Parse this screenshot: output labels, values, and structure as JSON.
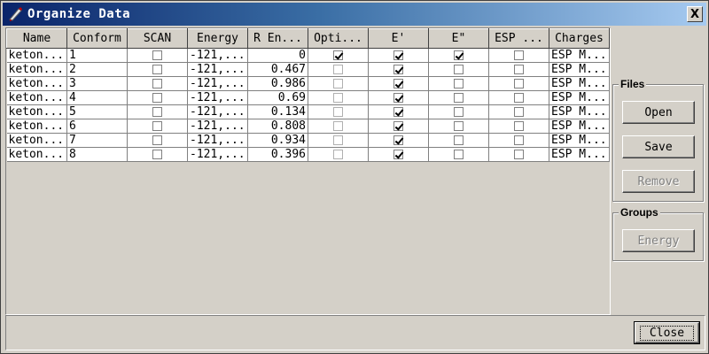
{
  "window": {
    "title": "Organize Data",
    "close_glyph": "X",
    "icon": "pen-icon"
  },
  "table": {
    "columns": [
      "Name",
      "Conform",
      "SCAN",
      "Energy",
      "R En...",
      "Opti...",
      "E'",
      "E\"",
      "ESP ...",
      "Charges"
    ],
    "rows": [
      {
        "name": "keton...",
        "conform": "1",
        "scan": false,
        "energy": "-121,...",
        "r_energy": "0",
        "opti": true,
        "e1": true,
        "e2": true,
        "esp": false,
        "charges": "ESP M..."
      },
      {
        "name": "keton...",
        "conform": "2",
        "scan": false,
        "energy": "-121,...",
        "r_energy": "0.467",
        "opti": false,
        "e1": true,
        "e2": false,
        "esp": false,
        "charges": "ESP M..."
      },
      {
        "name": "keton...",
        "conform": "3",
        "scan": false,
        "energy": "-121,...",
        "r_energy": "0.986",
        "opti": false,
        "e1": true,
        "e2": false,
        "esp": false,
        "charges": "ESP M..."
      },
      {
        "name": "keton...",
        "conform": "4",
        "scan": false,
        "energy": "-121,...",
        "r_energy": "0.69",
        "opti": false,
        "e1": true,
        "e2": false,
        "esp": false,
        "charges": "ESP M..."
      },
      {
        "name": "keton...",
        "conform": "5",
        "scan": false,
        "energy": "-121,...",
        "r_energy": "0.134",
        "opti": false,
        "e1": true,
        "e2": false,
        "esp": false,
        "charges": "ESP M..."
      },
      {
        "name": "keton...",
        "conform": "6",
        "scan": false,
        "energy": "-121,...",
        "r_energy": "0.808",
        "opti": false,
        "e1": true,
        "e2": false,
        "esp": false,
        "charges": "ESP M..."
      },
      {
        "name": "keton...",
        "conform": "7",
        "scan": false,
        "energy": "-121,...",
        "r_energy": "0.934",
        "opti": false,
        "e1": true,
        "e2": false,
        "esp": false,
        "charges": "ESP M..."
      },
      {
        "name": "keton...",
        "conform": "8",
        "scan": false,
        "energy": "-121,...",
        "r_energy": "0.396",
        "opti": false,
        "e1": true,
        "e2": false,
        "esp": false,
        "charges": "ESP M..."
      }
    ]
  },
  "files_group": {
    "label": "Files",
    "open": "Open",
    "save": "Save",
    "remove": "Remove"
  },
  "groups_group": {
    "label": "Groups",
    "energy": "Energy"
  },
  "footer": {
    "close": "Close"
  },
  "colors": {
    "face": "#d4d0c8",
    "title_start": "#0a246a",
    "title_end": "#a6caf0"
  }
}
